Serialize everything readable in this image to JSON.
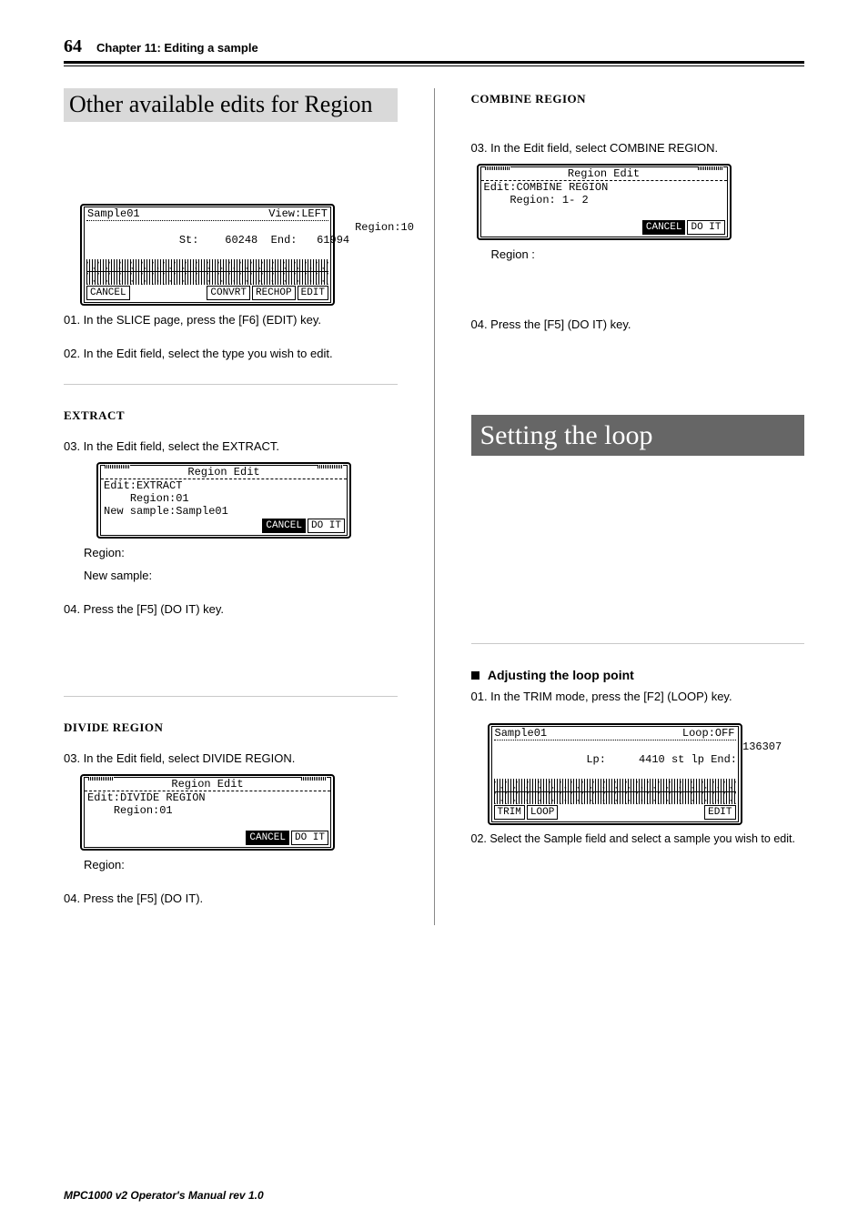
{
  "header": {
    "page_number": "64",
    "chapter_title": "Chapter 11: Editing a sample"
  },
  "left": {
    "main_heading": "Other available edits for Region",
    "slice_lcd": {
      "sample": "Sample01",
      "view": "View:LEFT",
      "st_label": "St:",
      "st_val": "60248",
      "end_label": "End:",
      "end_val": "61994",
      "region_label": "Region:10",
      "btn_cancel": "CANCEL",
      "btn_convrt": "CONVRT",
      "btn_rechop": "RECHOP",
      "btn_edit": "EDIT"
    },
    "step01": "01. In the SLICE page, press the [F6] (EDIT) key.",
    "step02": "02. In the Edit field, select the type you wish to edit.",
    "extract": {
      "heading": "EXTRACT",
      "step03": "03. In the Edit field, select the EXTRACT.",
      "lcd": {
        "title": "Region Edit",
        "edit": "Edit:EXTRACT",
        "region": "Region:01",
        "new_sample": "New sample:Sample01",
        "btn_cancel": "CANCEL",
        "btn_doit": "DO IT"
      },
      "label_region": "Region:",
      "label_new_sample": "New sample:",
      "step04": "04. Press the [F5] (DO IT) key."
    },
    "divide": {
      "heading": "DIVIDE REGION",
      "step03": "03. In the Edit field, select DIVIDE REGION.",
      "lcd": {
        "title": "Region Edit",
        "edit": "Edit:DIVIDE REGION",
        "region": "Region:01",
        "btn_cancel": "CANCEL",
        "btn_doit": "DO IT"
      },
      "label_region": "Region:",
      "step04": "04. Press the [F5] (DO IT)."
    }
  },
  "right": {
    "combine": {
      "heading": "COMBINE REGION",
      "step03": "03. In the Edit field, select COMBINE REGION.",
      "lcd": {
        "title": "Region Edit",
        "edit": "Edit:COMBINE REGION",
        "region": "Region: 1- 2",
        "btn_cancel": "CANCEL",
        "btn_doit": "DO IT"
      },
      "label_region": "Region :",
      "step04": "04. Press the [F5] (DO IT) key."
    },
    "loop": {
      "heading": "Setting the loop",
      "subhead": "Adjusting the loop point",
      "step01": "01. In the TRIM mode, press the [F2] (LOOP) key.",
      "lcd": {
        "sample": "Sample01",
        "loop_state": "Loop:OFF",
        "lp_label": "Lp:",
        "lp_val": "4410",
        "st_lp": "st lp",
        "end_label": "End:",
        "end_val": "136307",
        "btn_trim": "TRIM",
        "btn_loop": "LOOP",
        "btn_edit": "EDIT"
      },
      "step02": "02. Select the Sample field and select a sample you wish to edit."
    }
  },
  "footer": "MPC1000 v2 Operator's Manual  rev 1.0"
}
